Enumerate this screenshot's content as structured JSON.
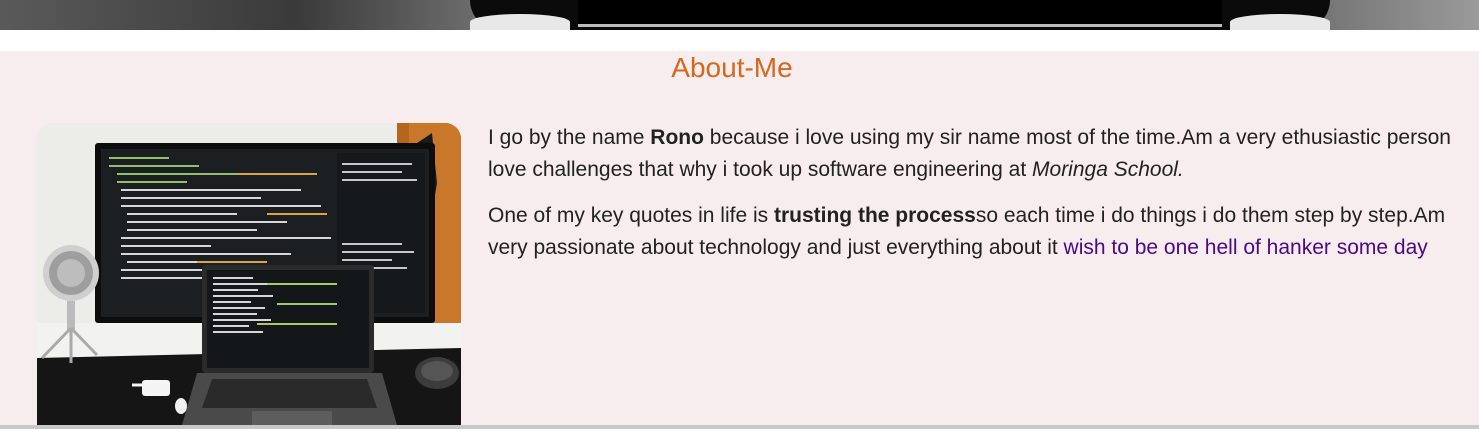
{
  "about": {
    "title": "About-Me",
    "para1": {
      "prefix": "I go by the name ",
      "name": "Rono",
      "middle": " because i love using my sir name most of the time.Am a very ethusiastic person",
      "line2_prefix": "love challenges that why i took up software engineering at ",
      "school": "Moringa School."
    },
    "para2": {
      "prefix": "One of my key quotes in life is ",
      "quote": "trusting the process",
      "middle": "so each time i do things i do them step by step.Am",
      "line2_prefix": "very passionate about technology and just everything about it ",
      "link": "wish to be one hell of hanker some day"
    }
  },
  "colors": {
    "title": "#d2691e",
    "section_bg": "#f7ecee",
    "link": "#4b0a82"
  },
  "image": {
    "subject": "desk-setup-photo"
  }
}
